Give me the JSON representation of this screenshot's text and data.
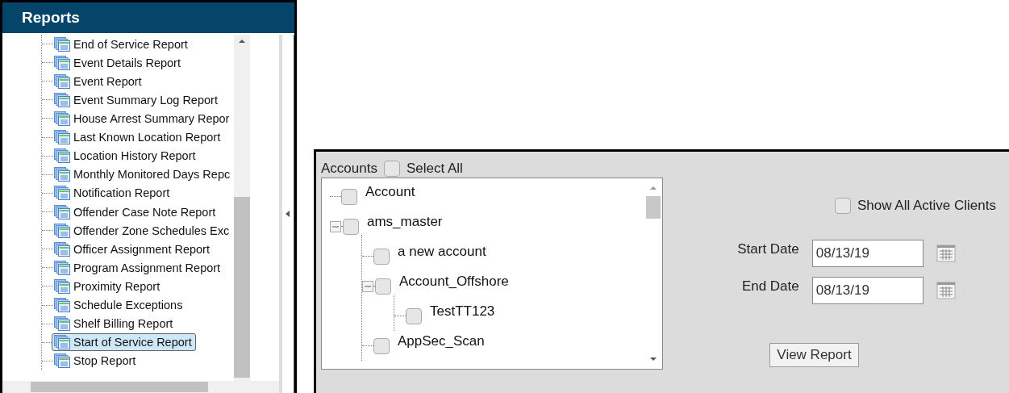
{
  "reports_panel": {
    "title": "Reports",
    "items": [
      {
        "label": "End of Service Report",
        "selected": false
      },
      {
        "label": "Event Details Report",
        "selected": false
      },
      {
        "label": "Event Report",
        "selected": false
      },
      {
        "label": "Event Summary Log Report",
        "selected": false
      },
      {
        "label": "House Arrest Summary Repor",
        "selected": false
      },
      {
        "label": "Last Known Location Report",
        "selected": false
      },
      {
        "label": "Location History Report",
        "selected": false
      },
      {
        "label": "Monthly Monitored Days Repc",
        "selected": false
      },
      {
        "label": "Notification Report",
        "selected": false
      },
      {
        "label": "Offender Case Note Report",
        "selected": false
      },
      {
        "label": "Offender Zone Schedules Exc",
        "selected": false
      },
      {
        "label": "Officer Assignment Report",
        "selected": false
      },
      {
        "label": "Program Assignment Report",
        "selected": false
      },
      {
        "label": "Proximity Report",
        "selected": false
      },
      {
        "label": "Schedule Exceptions",
        "selected": false
      },
      {
        "label": "Shelf Billing Report",
        "selected": false
      },
      {
        "label": "Start of Service Report",
        "selected": true
      },
      {
        "label": "Stop Report",
        "selected": false
      }
    ]
  },
  "accounts_panel": {
    "label": "Accounts",
    "select_all": {
      "label": "Select All",
      "checked": false
    },
    "tree": [
      {
        "label": "Account",
        "checked": false
      },
      {
        "label": "ams_master",
        "checked": false,
        "expanded": true,
        "children": [
          {
            "label": "a new account",
            "checked": false
          },
          {
            "label": "Account_Offshore",
            "checked": false,
            "expanded": true,
            "children": [
              {
                "label": "TestTT123",
                "checked": false
              }
            ]
          },
          {
            "label": "AppSec_Scan",
            "checked": false
          }
        ]
      }
    ]
  },
  "show_all_active_clients": {
    "label": "Show All Active Clients",
    "checked": false
  },
  "start_date": {
    "label": "Start Date",
    "value": "08/13/19"
  },
  "end_date": {
    "label": "End Date",
    "value": "08/13/19"
  },
  "view_report_button": "View Report"
}
